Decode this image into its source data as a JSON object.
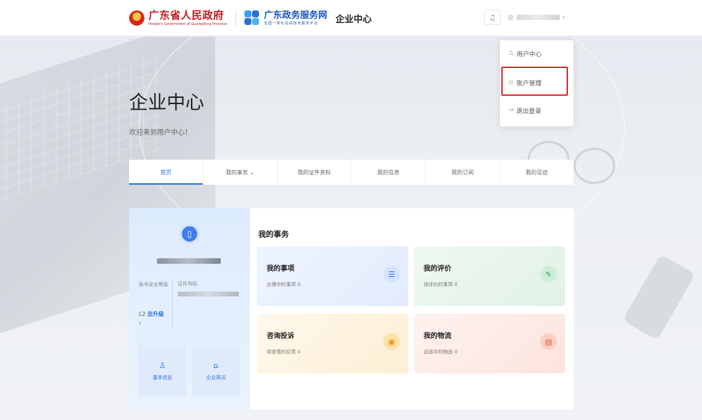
{
  "header": {
    "gov_name": "广东省人民政府",
    "gov_name_en": "People's Government of Guangdong Province",
    "portal_name": "广东政务服务网",
    "portal_slogan": "全国一体化在线政务服务平台",
    "site_name": "企业中心",
    "bell_icon": "bell-icon",
    "user_prefix": "◎",
    "user_caret": "›"
  },
  "user_menu": {
    "items": [
      {
        "icon": "user-icon",
        "glyph": "♙",
        "label": "用户中心"
      },
      {
        "icon": "account-manage-icon",
        "glyph": "◎",
        "label": "账户管理"
      },
      {
        "icon": "logout-icon",
        "glyph": "⇥",
        "label": "退出登录"
      }
    ],
    "highlight_color": "#e0232b"
  },
  "page": {
    "title": "企业中心",
    "subtitle": "欢迎来到用户中心！"
  },
  "tabs": [
    {
      "label": "首页",
      "active": true
    },
    {
      "label": "我的事务 ⌄",
      "active": false
    },
    {
      "label": "我的证件资料",
      "active": false
    },
    {
      "label": "我的信息",
      "active": false
    },
    {
      "label": "我的订阅",
      "active": false
    },
    {
      "label": "我的足迹",
      "active": false
    }
  ],
  "profile": {
    "avatar_glyph": "▯",
    "account_level_label": "账号安全等级",
    "level_value": "L2",
    "upgrade_label": "去升级",
    "arrow": "›",
    "id_label": "证件号码",
    "quick_buttons": [
      {
        "icon": "basic-info-icon",
        "glyph": "♙",
        "label": "基本信息"
      },
      {
        "icon": "enterprise-icon",
        "glyph": "⌂",
        "label": "企业简况"
      }
    ]
  },
  "affairs": {
    "heading": "我的事务",
    "tiles": [
      {
        "title": "我的事项",
        "sub": "办理中的事项 0",
        "icon": "list-icon",
        "glyph": "☰"
      },
      {
        "title": "我的评价",
        "sub": "待评价的事项 0",
        "icon": "edit-icon",
        "glyph": "✎"
      },
      {
        "title": "咨询投诉",
        "sub": "待查看的反馈 0",
        "icon": "feedback-icon",
        "glyph": "▣"
      },
      {
        "title": "我的物流",
        "sub": "运送中的物品 0",
        "icon": "logistics-icon",
        "glyph": "▤"
      }
    ]
  },
  "colors": {
    "accent": "#2d6ee0",
    "gov_red": "#c4161c",
    "portal_blue": "#1d57b5"
  }
}
